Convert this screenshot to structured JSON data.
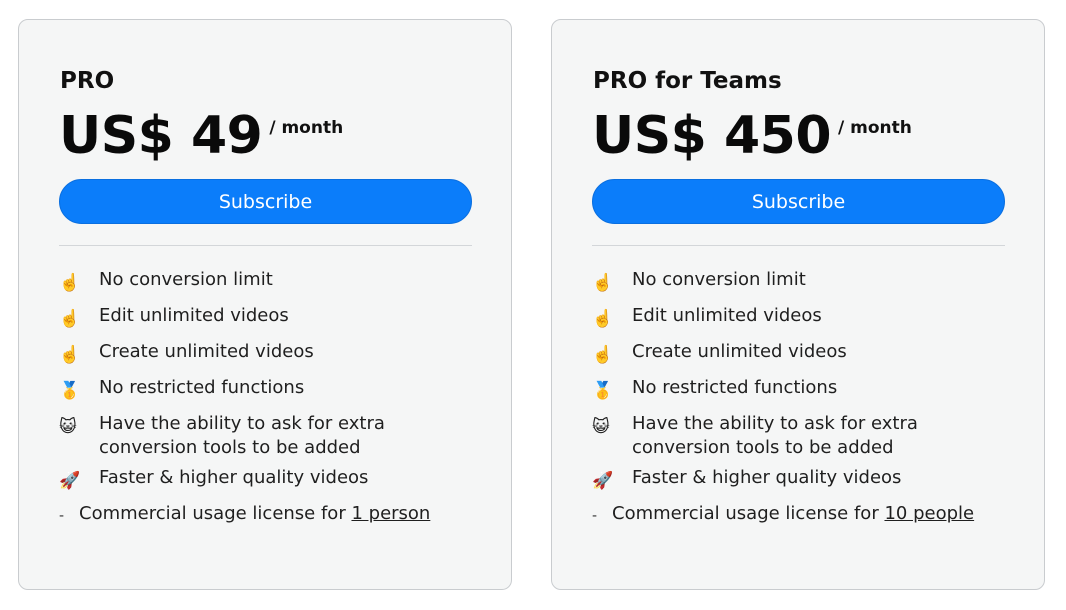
{
  "plans": [
    {
      "name": "PRO",
      "price": "US$ 49",
      "period": "/ month",
      "subscribe_label": "Subscribe",
      "features": [
        {
          "icon": "☝️",
          "icon_name": "pointing-finger-icon",
          "text": "No conversion limit"
        },
        {
          "icon": "☝️",
          "icon_name": "pointing-finger-icon",
          "text": "Edit unlimited videos"
        },
        {
          "icon": "☝️",
          "icon_name": "pointing-finger-icon",
          "text": "Create unlimited videos"
        },
        {
          "icon": "🥇",
          "icon_name": "gold-medal-icon",
          "text": "No restricted functions"
        },
        {
          "icon": "😺",
          "icon_name": "cat-face-icon",
          "text": "Have the ability to ask for extra conversion tools to be added"
        },
        {
          "icon": "🚀",
          "icon_name": "rocket-icon",
          "text": "Faster & higher quality videos"
        }
      ],
      "license": {
        "bullet": "-",
        "text": "Commercial usage license for",
        "link_text": "1 person"
      }
    },
    {
      "name": "PRO for Teams",
      "price": "US$ 450",
      "period": "/ month",
      "subscribe_label": "Subscribe",
      "features": [
        {
          "icon": "☝️",
          "icon_name": "pointing-finger-icon",
          "text": "No conversion limit"
        },
        {
          "icon": "☝️",
          "icon_name": "pointing-finger-icon",
          "text": "Edit unlimited videos"
        },
        {
          "icon": "☝️",
          "icon_name": "pointing-finger-icon",
          "text": "Create unlimited videos"
        },
        {
          "icon": "🥇",
          "icon_name": "gold-medal-icon",
          "text": "No restricted functions"
        },
        {
          "icon": "😺",
          "icon_name": "cat-face-icon",
          "text": "Have the ability to ask for extra conversion tools to be added"
        },
        {
          "icon": "🚀",
          "icon_name": "rocket-icon",
          "text": "Faster & higher quality videos"
        }
      ],
      "license": {
        "bullet": "-",
        "text": "Commercial usage license for",
        "link_text": "10 people"
      }
    }
  ],
  "colors": {
    "card_background": "#f5f6f6",
    "card_border": "#c9cccf",
    "button_background": "#0b7dfa",
    "button_text": "#ffffff"
  }
}
